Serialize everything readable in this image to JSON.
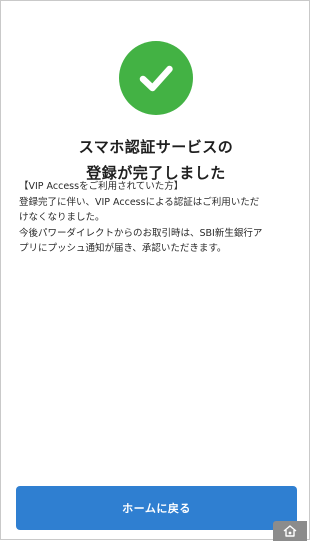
{
  "header": {
    "success_icon": "checkmark-circle-icon",
    "title_line1": "スマホ認証サービスの",
    "title_line2": "登録が完了しました"
  },
  "notice": {
    "heading": "【VIP Accessをご利用されていた方】",
    "line1": "登録完了に伴い、VIP Accessによる認証はご利用いただ",
    "line2": "けなくなりました。",
    "line3": "今後パワーダイレクトからのお取引時は、SBI新生銀行ア",
    "line4": "プリにプッシュ通知が届き、承認いただきます。"
  },
  "actions": {
    "home_button_label": "ホームに戻る"
  },
  "icons": {
    "corner": "home-mini-icon"
  },
  "colors": {
    "success": "#43b244",
    "primary": "#2f7fd1"
  }
}
